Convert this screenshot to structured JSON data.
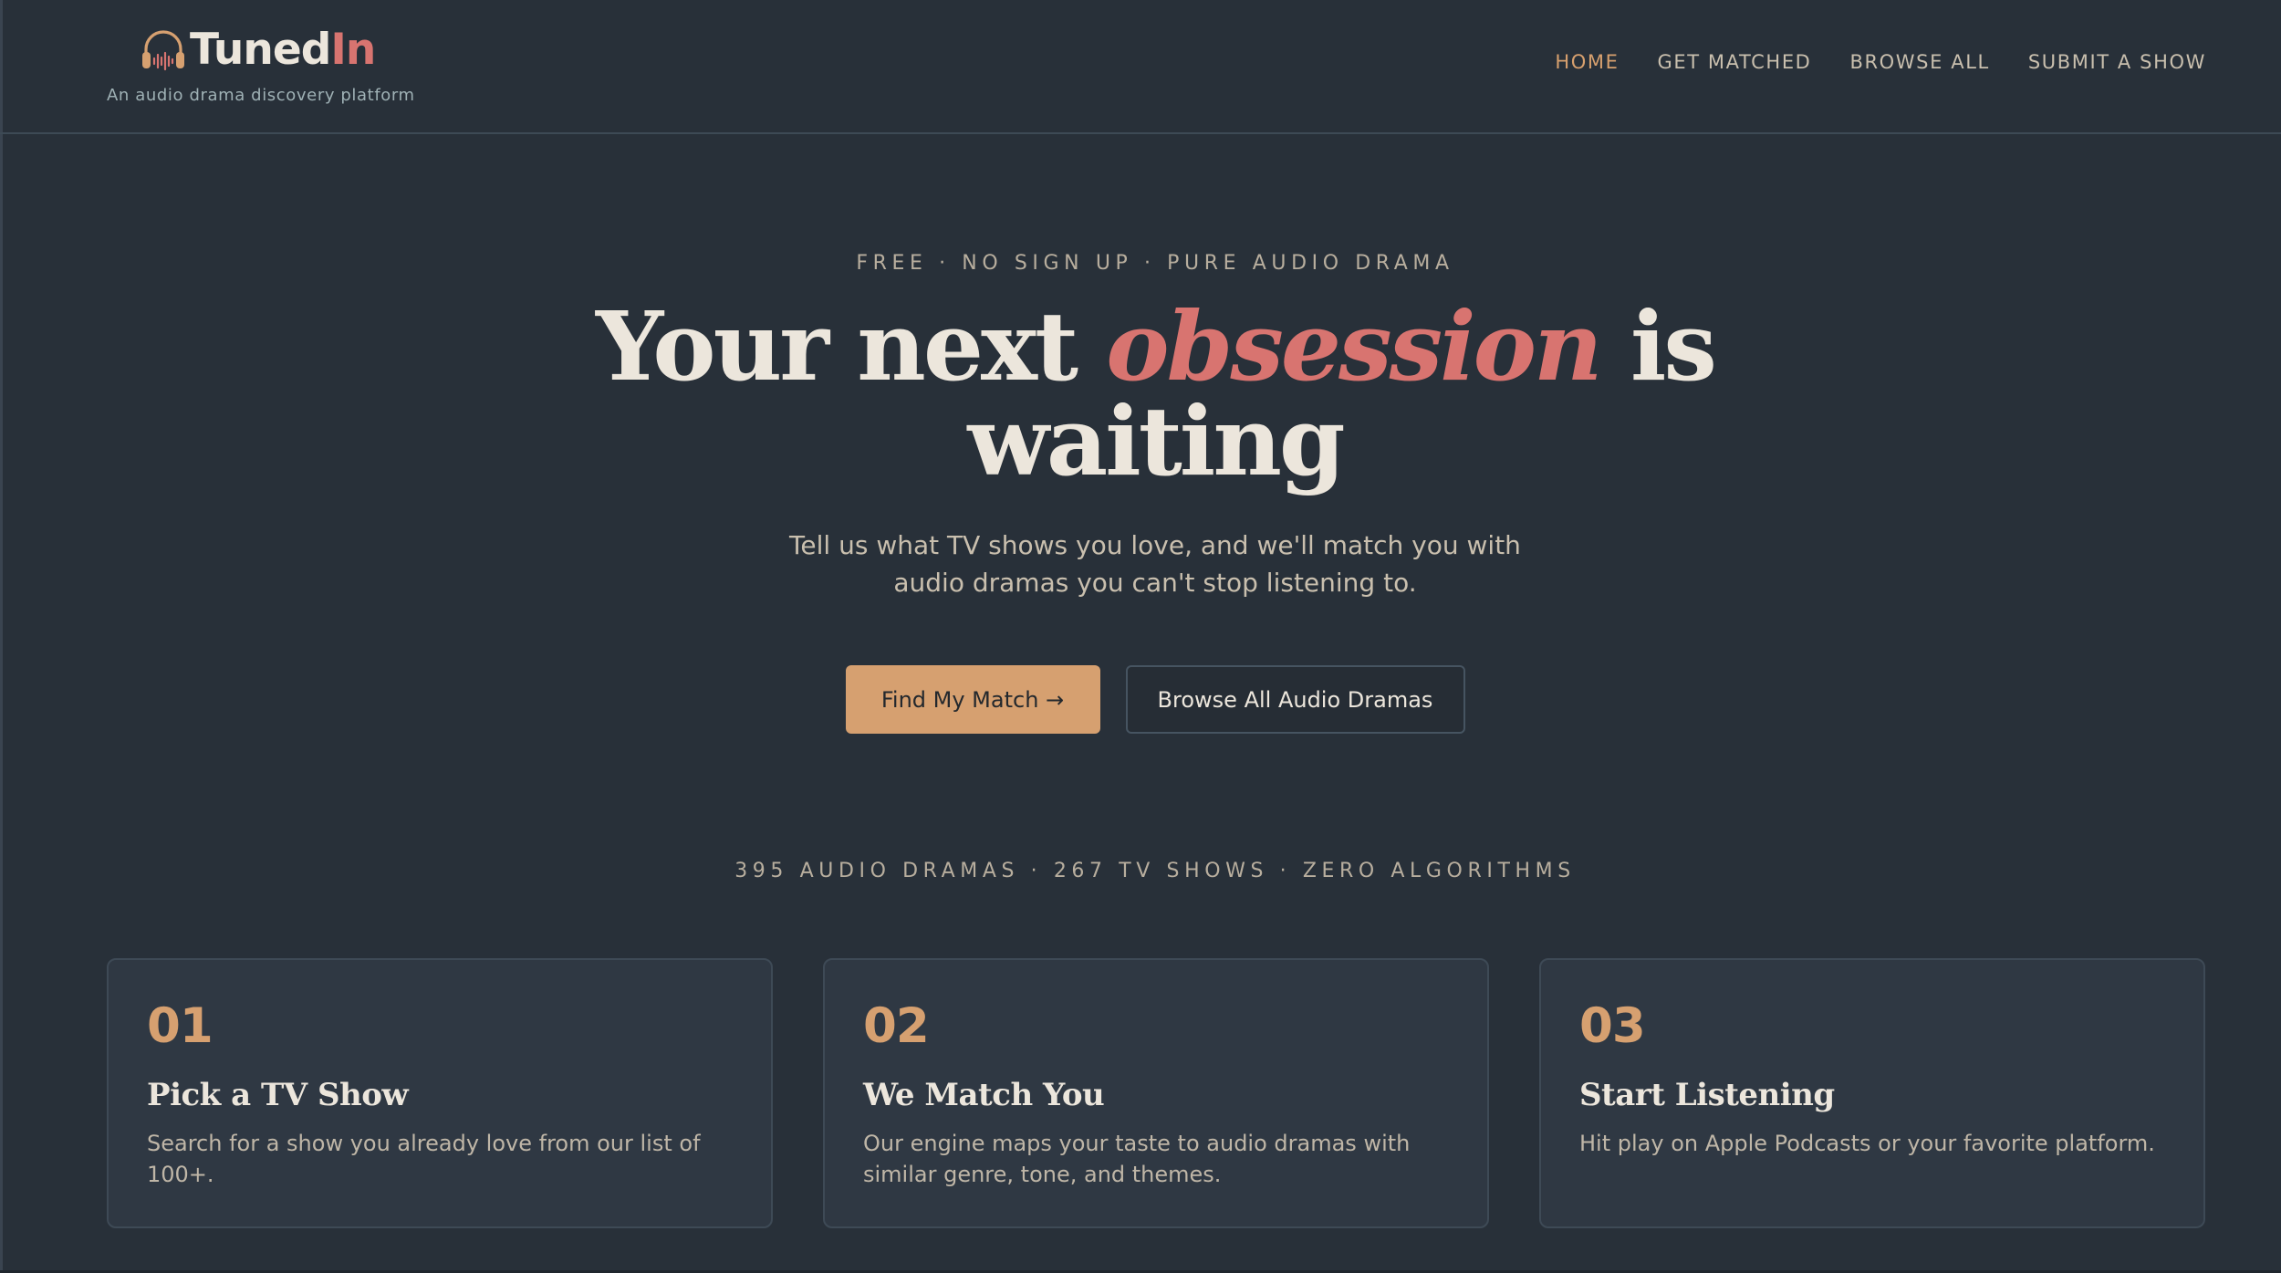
{
  "brand": {
    "name_main": "Tuned",
    "name_accent": "In",
    "tagline": "An audio drama discovery platform",
    "icon": "headphones-waveform-icon",
    "colors": {
      "accent": "#d6a070",
      "highlight": "#d87470",
      "background": "#283039"
    }
  },
  "nav": {
    "items": [
      {
        "label": "HOME",
        "active": true
      },
      {
        "label": "GET MATCHED",
        "active": false
      },
      {
        "label": "BROWSE ALL",
        "active": false
      },
      {
        "label": "SUBMIT A SHOW",
        "active": false
      }
    ]
  },
  "hero": {
    "eyebrow": "FREE · NO SIGN UP · PURE AUDIO DRAMA",
    "title_before": "Your next ",
    "title_highlight": "obsession",
    "title_after": " is",
    "title_line2": "waiting",
    "subtitle_line1": "Tell us what TV shows you love, and we'll match you with",
    "subtitle_line2": "audio dramas you can't stop listening to.",
    "primary_button": "Find My Match →",
    "secondary_button": "Browse All Audio Dramas"
  },
  "stats": "395 AUDIO DRAMAS · 267 TV SHOWS · ZERO ALGORITHMS",
  "steps": [
    {
      "number": "01",
      "title": "Pick a TV Show",
      "text": "Search for a show you already love from our list of 100+."
    },
    {
      "number": "02",
      "title": "We Match You",
      "text": "Our engine maps your taste to audio dramas with similar genre, tone, and themes."
    },
    {
      "number": "03",
      "title": "Start Listening",
      "text": "Hit play on Apple Podcasts or your favorite platform."
    }
  ]
}
